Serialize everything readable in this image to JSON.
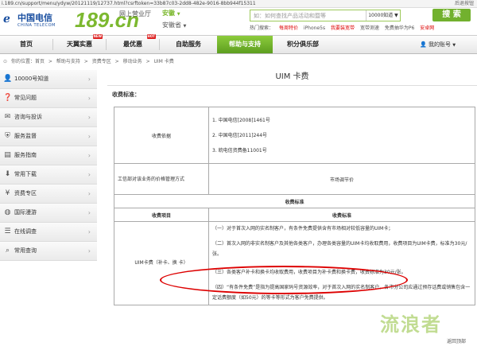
{
  "browser": {
    "url": "i.189.cn/support/menu/ydyw/20121119/12737.html?csrftoken=33b87c03-2dd8-482e-9016-8bb944f15311",
    "back": "后退按钮"
  },
  "header": {
    "logo_cn": "中国电信",
    "logo_en": "CHINA TELECOM",
    "brand": "189.cn",
    "net_hall": "网上营业厅",
    "province": "安徽",
    "province_arrow": "▼",
    "city": "安徽省",
    "city_arrow": "▼",
    "search_placeholder": "如：如何查找产品活动和暨等",
    "search_scope": "10000知道 ▼",
    "search_button": "搜 索",
    "hot_label": "热门搜索：",
    "hot_words": [
      "每周特价",
      "iPhone5s",
      "我要装宽带",
      "宽带测速",
      "免费抽华为P6",
      "安卓网"
    ]
  },
  "nav": {
    "items": [
      {
        "label": "首页",
        "hot": ""
      },
      {
        "label": "天翼实惠",
        "hot": "NEW"
      },
      {
        "label": "最优惠",
        "hot": "HOT"
      },
      {
        "label": "自助服务",
        "hot": ""
      },
      {
        "label": "帮助与支持",
        "hot": ""
      },
      {
        "label": "积分俱乐部",
        "hot": ""
      }
    ],
    "account": "我的账号",
    "account_arrow": "▼"
  },
  "breadcrumb": [
    "你的位置：首页",
    ">",
    "帮助与支持",
    ">",
    "资费专区",
    ">",
    "移动业务",
    ">",
    "UIM 卡费"
  ],
  "sidebar": [
    {
      "label": "10000号知道",
      "icon": "person-icon"
    },
    {
      "label": "常见问题",
      "icon": "question-icon"
    },
    {
      "label": "咨询与投诉",
      "icon": "chat-icon"
    },
    {
      "label": "服务监督",
      "icon": "shield-icon"
    },
    {
      "label": "服务指南",
      "icon": "book-icon"
    },
    {
      "label": "常用下载",
      "icon": "download-icon"
    },
    {
      "label": "资费专区",
      "icon": "money-icon"
    },
    {
      "label": "国际漫游",
      "icon": "globe-icon"
    },
    {
      "label": "在线调查",
      "icon": "survey-icon"
    },
    {
      "label": "常用查询",
      "icon": "search-icon"
    }
  ],
  "sidebar_arrow": "›",
  "main": {
    "title": "UIM 卡费",
    "fee_standard_label": "收费标准：",
    "table": {
      "basis_label": "收费依据",
      "basis_items": [
        "1. 中国电信[2008]1461号",
        "2. 中国电信[2011]244号",
        "3. 皖电信资费备11001号"
      ],
      "mgmt_label": "工信部对该业务的价格管理方式",
      "mgmt_value": "市场调节价",
      "std_header": "收费标准",
      "col_item": "收费项目",
      "col_std": "收费标准",
      "item_name": "UIM卡费（补卡、换 卡）",
      "rules": [
        "（一）对于首次入网的实名制客户，有条件免费提供含有市场相对较低容量的UIM卡；",
        "（二）首次入网的非实名制客户及其他各类客户，办理各类容量的UIM卡均收取费用，收费项目为UIM卡费，标准为30元/张。",
        "（三）各类客户补卡和换卡均收取费用，收费项目为补卡费和换卡费，收费标准为30元/张。",
        "（四）“有条件免费”是指为提高国家码号资源效率，对于首次入网的实名制客户，各市分公司应通过预存话费或销售包含一定话费额度（如50元）的等卡等形式为客户免费提供。"
      ]
    }
  },
  "watermark": "流浪者",
  "back_to_top": "返回顶部"
}
